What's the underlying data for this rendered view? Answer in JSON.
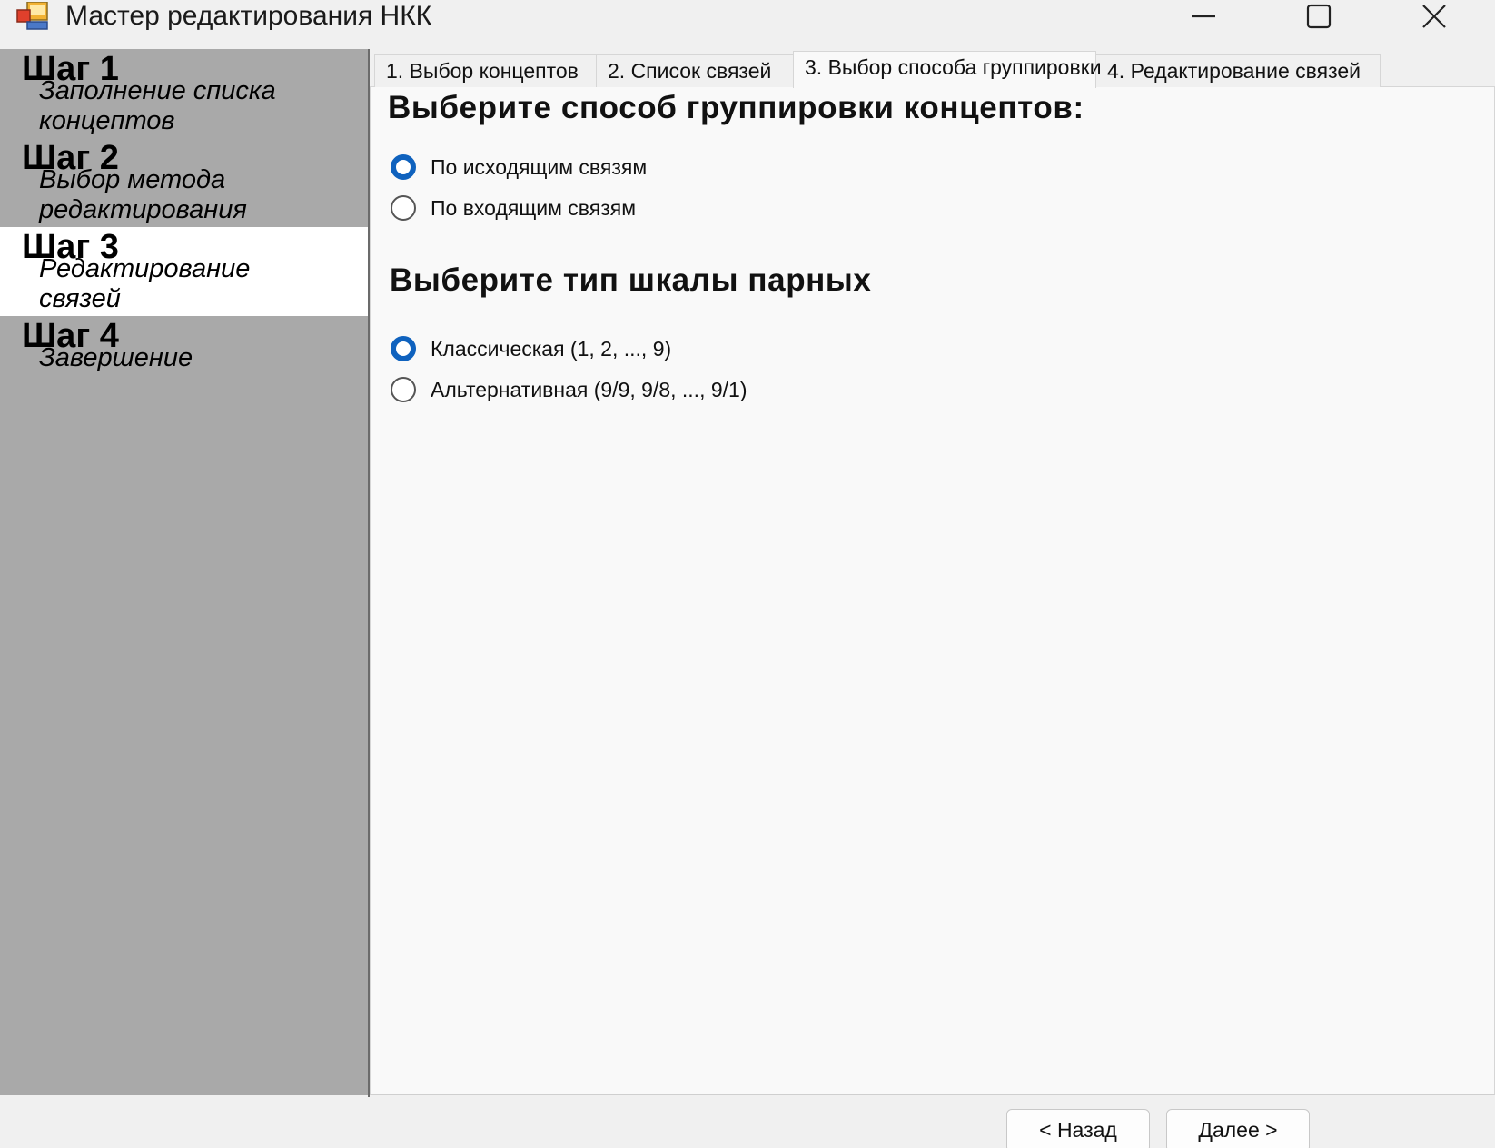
{
  "window": {
    "title": "Мастер редактирования НКК",
    "icon": "app-icon",
    "controls": [
      "minimize-icon",
      "maximize-icon",
      "close-icon"
    ]
  },
  "sidebar": {
    "active_step": 3,
    "steps": [
      {
        "title": "Шаг 1",
        "description": "Заполнение списка концептов"
      },
      {
        "title": "Шаг 2",
        "description": "Выбор метода редактирования"
      },
      {
        "title": "Шаг 3",
        "description": "Редактирование связей"
      },
      {
        "title": "Шаг 4",
        "description": "Завершение"
      }
    ]
  },
  "tabs": [
    {
      "label": "1. Выбор концептов"
    },
    {
      "label": "2. Список связей"
    },
    {
      "label": "3. Выбор способа группировки",
      "active": true
    },
    {
      "label": "4. Редактирование связей"
    }
  ],
  "grouping": {
    "heading": "Выберите способ группировки концептов:",
    "options": [
      {
        "label": "По исходящим связям",
        "checked": true
      },
      {
        "label": "По входящим связям",
        "checked": false
      }
    ]
  },
  "scale": {
    "heading": "Выберите тип шкалы парных",
    "options": [
      {
        "label": "Классическая (1, 2, ..., 9)",
        "checked": true
      },
      {
        "label": "Альтернативная (9/9, 9/8, ..., 9/1)",
        "checked": false
      }
    ]
  },
  "footer": {
    "back_label": "< Назад",
    "next_label": "Далее >"
  },
  "colors": {
    "sidebar_bg": "#a9a9a9",
    "active_step_bg": "#ffffff",
    "radio_accent": "#0f62be",
    "panel_bg": "#f9f9f9"
  }
}
